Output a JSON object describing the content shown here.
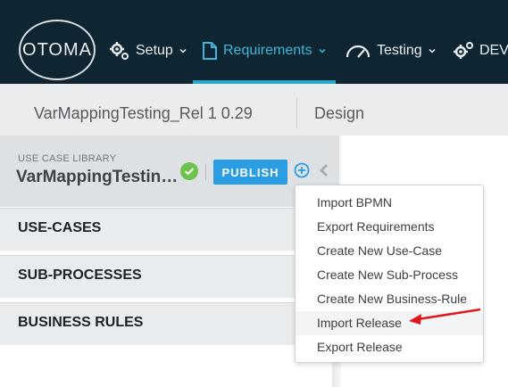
{
  "nav": {
    "logo_text": "OTOMA",
    "items": [
      {
        "label": "Setup",
        "icon": "gears-icon"
      },
      {
        "label": "Requirements",
        "icon": "document-icon"
      },
      {
        "label": "Testing",
        "icon": "gauge-icon"
      },
      {
        "label": "DEV",
        "icon": "gears-icon"
      }
    ],
    "active_color": "#3fb7d8"
  },
  "breadcrumb": {
    "project": "VarMappingTesting_Rel 1 0.29",
    "view": "Design"
  },
  "library": {
    "label": "USE CASE LIBRARY",
    "name": "VarMappingTestin…",
    "publish_label": "PUBLISH"
  },
  "sections": [
    "USE-CASES",
    "SUB-PROCESSES",
    "BUSINESS RULES"
  ],
  "menu": {
    "items": [
      "Import BPMN",
      "Export Requirements",
      "Create New Use-Case",
      "Create New Sub-Process",
      "Create New Business-Rule",
      "Import Release",
      "Export Release"
    ],
    "highlighted_index": 5
  },
  "annotation_color": "#e0181b"
}
